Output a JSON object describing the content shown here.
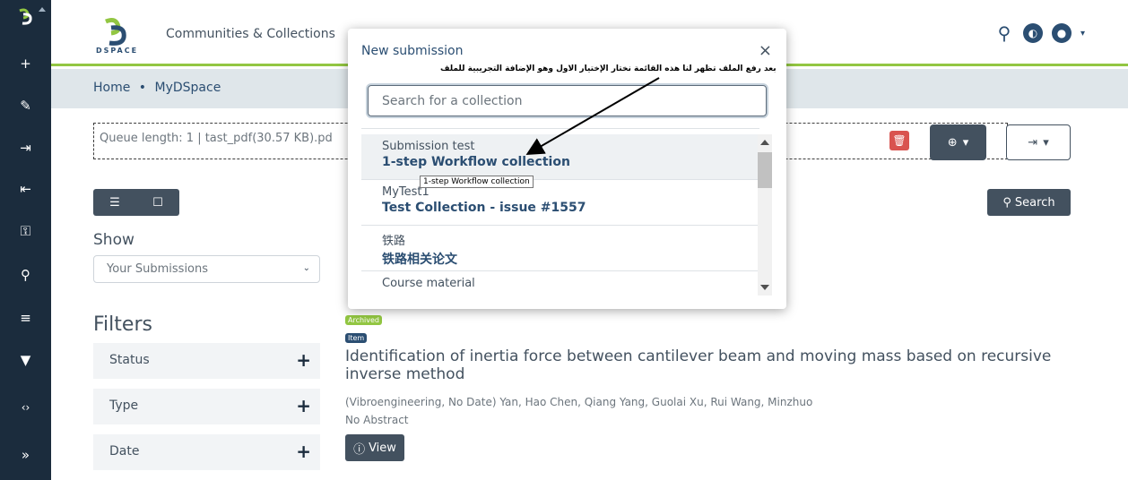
{
  "sidebar": {
    "items": [
      {
        "icon": "plus-icon",
        "glyph": "+"
      },
      {
        "icon": "pencil-icon",
        "glyph": "✎"
      },
      {
        "icon": "import-icon",
        "glyph": "⇥"
      },
      {
        "icon": "export-icon",
        "glyph": "⇤"
      },
      {
        "icon": "key-icon",
        "glyph": "⚿"
      },
      {
        "icon": "search-icon",
        "glyph": "⚲"
      },
      {
        "icon": "list-icon",
        "glyph": "≡"
      },
      {
        "icon": "filter-icon",
        "glyph": "▼"
      },
      {
        "icon": "code-icon",
        "glyph": "‹›"
      },
      {
        "icon": "expand-icon",
        "glyph": "»"
      }
    ]
  },
  "header": {
    "logo_text": "DSPACE",
    "nav_link": "Communities & Collections"
  },
  "breadcrumb": {
    "home": "Home",
    "separator": "•",
    "current": "MyDSpace"
  },
  "upload": {
    "queue_text": "Queue length: 1 | tast_pdf(30.57 KB).pd"
  },
  "toolbar": {
    "search_label": "Search"
  },
  "filters": {
    "show_label": "Show",
    "select_value": "Your Submissions",
    "title": "Filters",
    "items": [
      {
        "label": "Status"
      },
      {
        "label": "Type"
      },
      {
        "label": "Date"
      }
    ]
  },
  "result": {
    "badge_archived": "Archived",
    "badge_item": "Item",
    "title": "Identification of inertia force between cantilever beam and moving mass based on recursive inverse method",
    "meta": "(Vibroengineering, No Date) Yan, Hao Chen, Qiang Yang, Guolai Xu, Rui Wang, Minzhuo",
    "abstract": "No Abstract",
    "view_label": "View"
  },
  "modal": {
    "title": "New submission",
    "close": "×",
    "annotation": "بعد رفع الملف تظهر لنا هذه القائمة نختار الإختيار الاول وهو الإضافة التجريبية للملف",
    "search_placeholder": "Search for a collection",
    "tooltip": "1-step Workflow collection",
    "collections": [
      {
        "community": "Submission test",
        "name": "1-step Workflow collection"
      },
      {
        "community": "MyTest1",
        "name": "Test Collection - issue #1557"
      },
      {
        "community": "铁路",
        "name": "铁路相关论文"
      },
      {
        "community": "Course material",
        "name": ""
      }
    ]
  },
  "colors": {
    "sidebar_bg": "#1b2c3d",
    "brand_green": "#92c642",
    "primary_dark": "#43515f",
    "danger": "#d9534f",
    "badge_archived": "#92c642",
    "badge_item": "#2b4e72"
  }
}
